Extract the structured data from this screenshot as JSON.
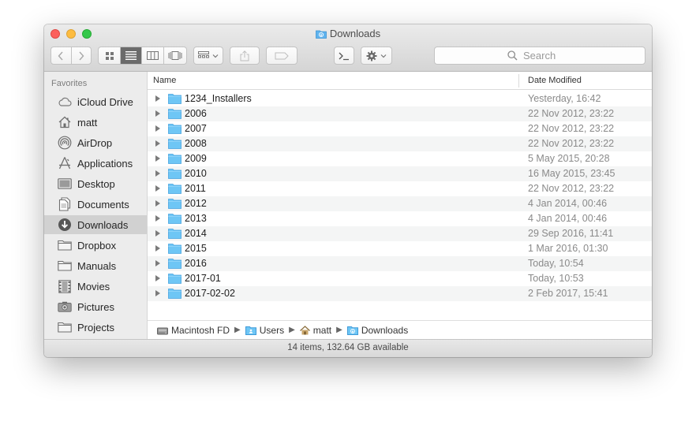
{
  "window": {
    "title": "Downloads"
  },
  "toolbar": {
    "search_placeholder": "Search"
  },
  "sidebar": {
    "heading": "Favorites",
    "items": [
      {
        "label": "iCloud Drive",
        "icon": "cloud-icon"
      },
      {
        "label": "matt",
        "icon": "home-icon"
      },
      {
        "label": "AirDrop",
        "icon": "airdrop-icon"
      },
      {
        "label": "Applications",
        "icon": "applications-icon"
      },
      {
        "label": "Desktop",
        "icon": "desktop-icon"
      },
      {
        "label": "Documents",
        "icon": "documents-icon"
      },
      {
        "label": "Downloads",
        "icon": "downloads-icon",
        "active": true
      },
      {
        "label": "Dropbox",
        "icon": "folder-icon"
      },
      {
        "label": "Manuals",
        "icon": "folder-icon"
      },
      {
        "label": "Movies",
        "icon": "film-icon"
      },
      {
        "label": "Pictures",
        "icon": "camera-icon"
      },
      {
        "label": "Projects",
        "icon": "folder-icon"
      }
    ]
  },
  "columns": {
    "name": "Name",
    "date": "Date Modified"
  },
  "files": [
    {
      "name": "1234_Installers",
      "date": "Yesterday, 16:42"
    },
    {
      "name": "2006",
      "date": "22 Nov 2012, 23:22"
    },
    {
      "name": "2007",
      "date": "22 Nov 2012, 23:22"
    },
    {
      "name": "2008",
      "date": "22 Nov 2012, 23:22"
    },
    {
      "name": "2009",
      "date": "5 May 2015, 20:28"
    },
    {
      "name": "2010",
      "date": "16 May 2015, 23:45"
    },
    {
      "name": "2011",
      "date": "22 Nov 2012, 23:22"
    },
    {
      "name": "2012",
      "date": "4 Jan 2014, 00:46"
    },
    {
      "name": "2013",
      "date": "4 Jan 2014, 00:46"
    },
    {
      "name": "2014",
      "date": "29 Sep 2016, 11:41"
    },
    {
      "name": "2015",
      "date": "1 Mar 2016, 01:30"
    },
    {
      "name": "2016",
      "date": "Today, 10:54"
    },
    {
      "name": "2017-01",
      "date": "Today, 10:53"
    },
    {
      "name": "2017-02-02",
      "date": "2 Feb 2017, 15:41"
    }
  ],
  "path": [
    {
      "label": "Macintosh FD",
      "icon": "disk-icon"
    },
    {
      "label": "Users",
      "icon": "folder-icon"
    },
    {
      "label": "matt",
      "icon": "home-icon"
    },
    {
      "label": "Downloads",
      "icon": "downloads-folder-icon"
    }
  ],
  "status": "14 items, 132.64 GB available",
  "colors": {
    "folder": "#6ec6f5",
    "selection": "#d1d1d1",
    "alt_row": "#f4f5f5"
  }
}
